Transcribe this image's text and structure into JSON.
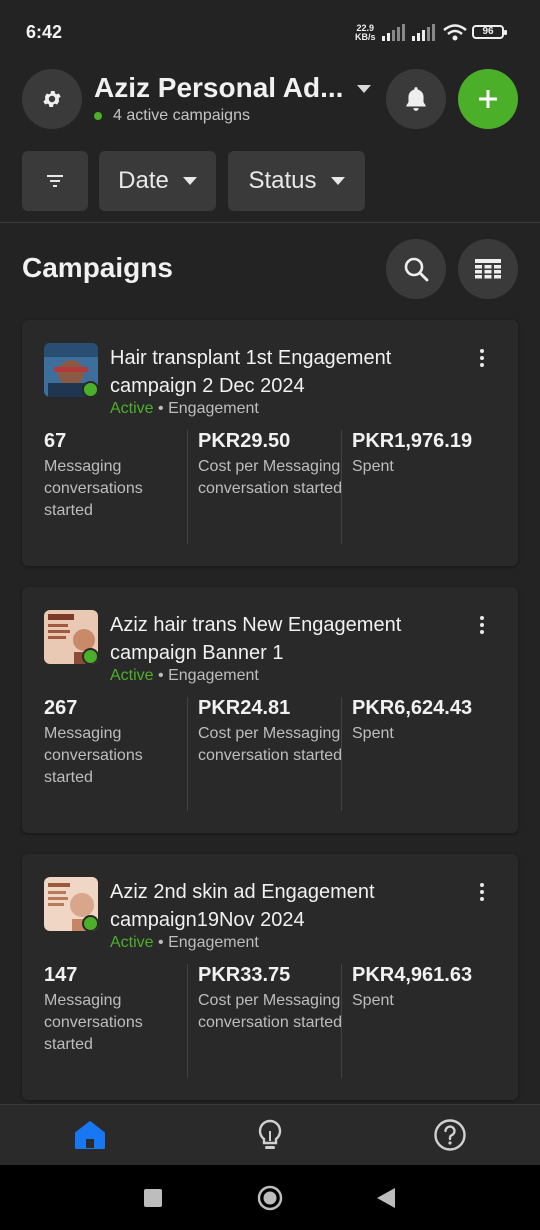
{
  "status_bar": {
    "time": "6:42",
    "net_speed": "22.9",
    "net_unit": "KB/s",
    "battery": "96"
  },
  "header": {
    "account_name": "Aziz Personal Ad...",
    "active_campaigns": "4 active campaigns",
    "settings_icon": "gear-icon",
    "notifications_icon": "bell-icon",
    "create_icon": "plus-icon",
    "accent_color": "#4caf2a"
  },
  "filters": {
    "filter_icon": "filter-icon",
    "date_label": "Date",
    "status_label": "Status"
  },
  "section": {
    "title": "Campaigns",
    "search_icon": "search-icon",
    "table_icon": "table-icon"
  },
  "campaigns": [
    {
      "name": "Hair transplant 1st Engagement campaign 2 Dec 2024",
      "status": "Active",
      "separator": "•",
      "objective": "Engagement",
      "results_value": "67",
      "results_label": "Messaging conversations started",
      "cost_value": "PKR29.50",
      "cost_label": "Cost per Messaging conversation started",
      "spent_value": "PKR1,976.19",
      "spent_label": "Spent"
    },
    {
      "name": "Aziz hair trans New Engagement campaign Banner 1",
      "status": "Active",
      "separator": "•",
      "objective": "Engagement",
      "results_value": "267",
      "results_label": "Messaging conversations started",
      "cost_value": "PKR24.81",
      "cost_label": "Cost per Messaging conversation started",
      "spent_value": "PKR6,624.43",
      "spent_label": "Spent"
    },
    {
      "name": "Aziz 2nd skin ad Engagement campaign19Nov 2024",
      "status": "Active",
      "separator": "•",
      "objective": "Engagement",
      "results_value": "147",
      "results_label": "Messaging conversations started",
      "cost_value": "PKR33.75",
      "cost_label": "Cost per Messaging conversation started",
      "spent_value": "PKR4,961.63",
      "spent_label": "Spent"
    }
  ],
  "bottom_nav": {
    "home_icon": "home-icon",
    "insights_icon": "lightbulb-icon",
    "help_icon": "help-icon",
    "active_color": "#1877f2"
  },
  "system_nav": {
    "recents_icon": "square-icon",
    "home_icon": "circle-icon",
    "back_icon": "back-triangle-icon"
  }
}
